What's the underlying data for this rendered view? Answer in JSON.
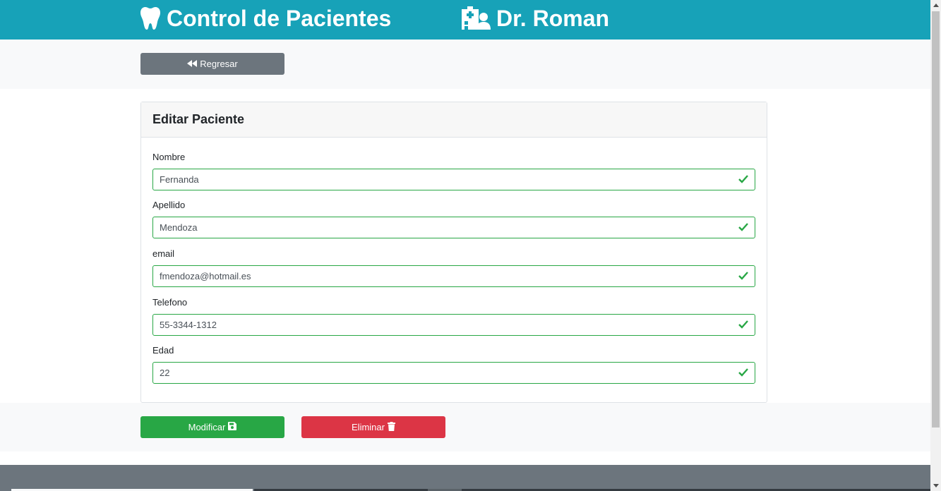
{
  "header": {
    "app_title": "Control de Pacientes",
    "doctor_name": "Dr. Roman",
    "app_icon": "tooth-icon",
    "doctor_icon": "clinic-user-icon"
  },
  "toolbar": {
    "back_label": "Regresar",
    "back_icon": "backward-icon"
  },
  "card": {
    "title": "Editar Paciente",
    "fields": [
      {
        "label": "Nombre",
        "value": "Fernanda"
      },
      {
        "label": "Apellido",
        "value": "Mendoza"
      },
      {
        "label": "email",
        "value": "fmendoza@hotmail.es"
      },
      {
        "label": "Telefono",
        "value": "55-3344-1312"
      },
      {
        "label": "Edad",
        "value": "22"
      }
    ]
  },
  "actions": {
    "save_label": "Modificar",
    "save_icon": "floppy-disk-icon",
    "delete_label": "Eliminar",
    "delete_icon": "trash-icon"
  },
  "colors": {
    "header_bg": "#17a2b8",
    "valid_green": "#28a745",
    "danger_red": "#dc3545",
    "secondary_gray": "#6c757d"
  }
}
